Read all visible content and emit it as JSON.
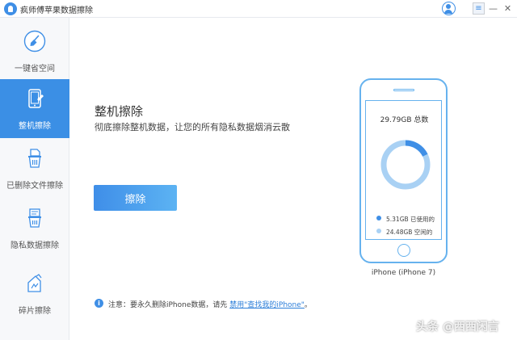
{
  "window": {
    "title": "疯师傅苹果数据擦除"
  },
  "titlebar": {
    "menu_glyph": "≡",
    "minimize_glyph": "—",
    "close_glyph": "✕"
  },
  "sidebar": {
    "items": [
      {
        "label": "一键省空间",
        "icon": "broom-icon",
        "active": false
      },
      {
        "label": "整机擦除",
        "icon": "phone-erase-icon",
        "active": true
      },
      {
        "label": "已删除文件擦除",
        "icon": "file-trash-icon",
        "active": false
      },
      {
        "label": "隐私数据擦除",
        "icon": "privacy-trash-icon",
        "active": false
      },
      {
        "label": "碎片擦除",
        "icon": "fragment-erase-icon",
        "active": false
      }
    ]
  },
  "main": {
    "title": "整机擦除",
    "description": "彻底擦除整机数据，让您的所有隐私数据烟消云散",
    "erase_button": "擦除",
    "notice_icon": "i",
    "notice_prefix": "注意：要永久删除iPhone数据，请先 ",
    "notice_link": "禁用\"查找我的iPhone\"",
    "notice_suffix": "。"
  },
  "device": {
    "total": "29.79GB 总数",
    "used_label": "5.31GB 已使用的",
    "free_label": "24.48GB 空闲的",
    "used_fraction": 0.178,
    "name": "iPhone (iPhone 7)"
  },
  "colors": {
    "accent": "#3b8fe5",
    "used": "#3f8fe6",
    "free": "#a9d1f4"
  },
  "watermark": {
    "text": "头条 @西西闲言"
  }
}
